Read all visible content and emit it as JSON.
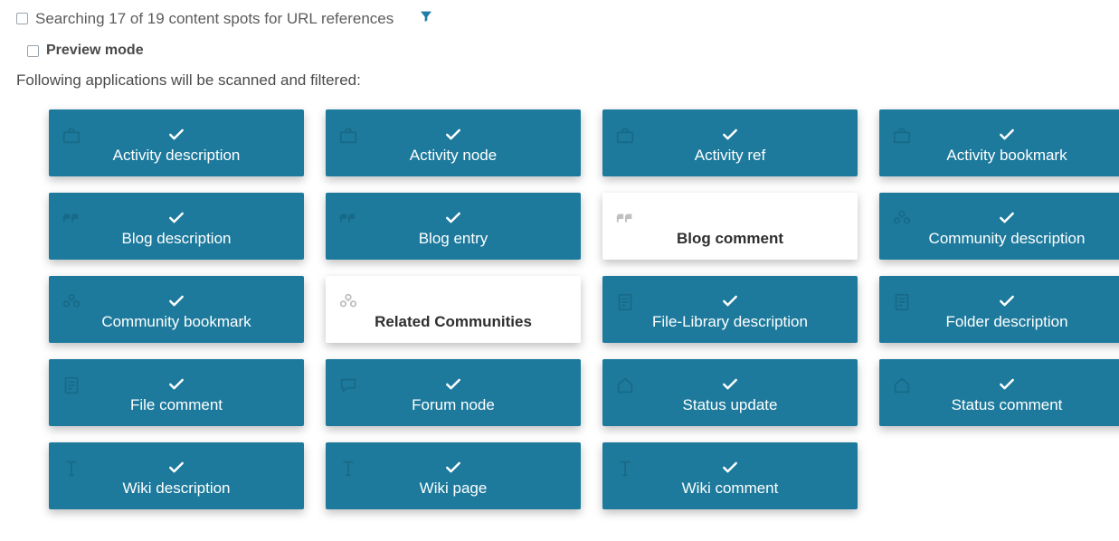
{
  "header": {
    "status_text": "Searching 17 of 19 content spots for URL references",
    "preview_label": "Preview mode",
    "description": "Following applications will be scanned and filtered:"
  },
  "tiles": [
    {
      "label": "Activity description",
      "selected": true,
      "icon": "briefcase"
    },
    {
      "label": "Activity node",
      "selected": true,
      "icon": "briefcase"
    },
    {
      "label": "Activity ref",
      "selected": true,
      "icon": "briefcase"
    },
    {
      "label": "Activity bookmark",
      "selected": true,
      "icon": "briefcase"
    },
    {
      "label": "Blog description",
      "selected": true,
      "icon": "quote"
    },
    {
      "label": "Blog entry",
      "selected": true,
      "icon": "quote"
    },
    {
      "label": "Blog comment",
      "selected": false,
      "icon": "quote"
    },
    {
      "label": "Community description",
      "selected": true,
      "icon": "people"
    },
    {
      "label": "Community bookmark",
      "selected": true,
      "icon": "people"
    },
    {
      "label": "Related Communities",
      "selected": false,
      "icon": "people"
    },
    {
      "label": "File-Library description",
      "selected": true,
      "icon": "file"
    },
    {
      "label": "Folder description",
      "selected": true,
      "icon": "file"
    },
    {
      "label": "File comment",
      "selected": true,
      "icon": "file"
    },
    {
      "label": "Forum node",
      "selected": true,
      "icon": "chat"
    },
    {
      "label": "Status update",
      "selected": true,
      "icon": "home"
    },
    {
      "label": "Status comment",
      "selected": true,
      "icon": "home"
    },
    {
      "label": "Wiki description",
      "selected": true,
      "icon": "text"
    },
    {
      "label": "Wiki page",
      "selected": true,
      "icon": "text"
    },
    {
      "label": "Wiki comment",
      "selected": true,
      "icon": "text"
    }
  ],
  "colors": {
    "tile_selected": "#1d7a9c",
    "tile_unselected": "#ffffff"
  }
}
